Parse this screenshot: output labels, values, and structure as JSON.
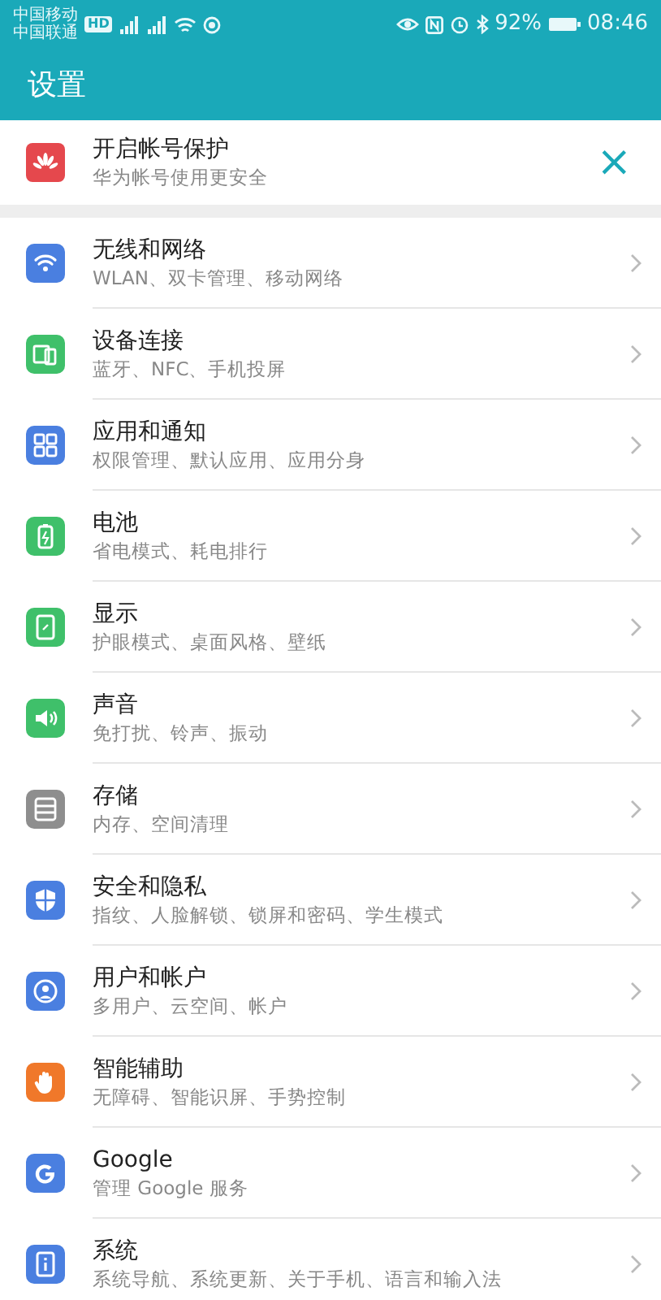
{
  "status_bar": {
    "carriers": [
      "中国移动",
      "中国联通"
    ],
    "hd_badge": "HD",
    "battery_text": "92%",
    "time": "08:46"
  },
  "header": {
    "title": "设置"
  },
  "banner": {
    "title": "开启帐号保护",
    "subtitle": "华为帐号使用更安全",
    "close": "×"
  },
  "items": [
    {
      "kind": "wifi",
      "color": "#4a7fe0",
      "title": "无线和网络",
      "subtitle": "WLAN、双卡管理、移动网络"
    },
    {
      "kind": "devices",
      "color": "#3fc06a",
      "title": "设备连接",
      "subtitle": "蓝牙、NFC、手机投屏"
    },
    {
      "kind": "apps",
      "color": "#4a7fe0",
      "title": "应用和通知",
      "subtitle": "权限管理、默认应用、应用分身"
    },
    {
      "kind": "battery",
      "color": "#3fc06a",
      "title": "电池",
      "subtitle": "省电模式、耗电排行"
    },
    {
      "kind": "display",
      "color": "#3fc06a",
      "title": "显示",
      "subtitle": "护眼模式、桌面风格、壁纸"
    },
    {
      "kind": "sound",
      "color": "#3fc06a",
      "title": "声音",
      "subtitle": "免打扰、铃声、振动"
    },
    {
      "kind": "storage",
      "color": "#8e8e8e",
      "title": "存储",
      "subtitle": "内存、空间清理"
    },
    {
      "kind": "shield",
      "color": "#4a7fe0",
      "title": "安全和隐私",
      "subtitle": "指纹、人脸解锁、锁屏和密码、学生模式"
    },
    {
      "kind": "user",
      "color": "#4a7fe0",
      "title": "用户和帐户",
      "subtitle": "多用户、云空间、帐户"
    },
    {
      "kind": "hand",
      "color": "#f0782a",
      "title": "智能辅助",
      "subtitle": "无障碍、智能识屏、手势控制"
    },
    {
      "kind": "google",
      "color": "#4a7fe0",
      "title": "Google",
      "subtitle": "管理 Google 服务"
    },
    {
      "kind": "system",
      "color": "#4a7fe0",
      "title": "系统",
      "subtitle": "系统导航、系统更新、关于手机、语言和输入法"
    }
  ]
}
